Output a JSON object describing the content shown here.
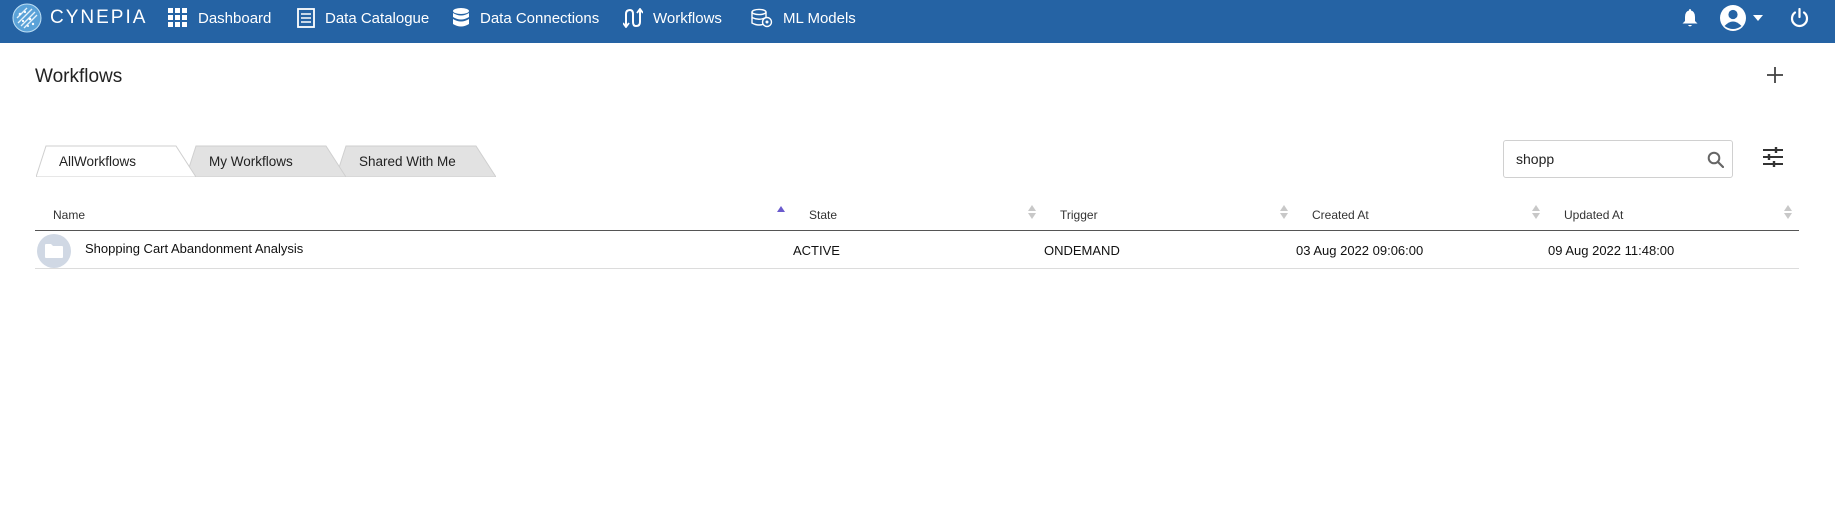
{
  "nav": {
    "brand": "CYNEPIA",
    "items": [
      {
        "label": "Dashboard",
        "icon": "grid-icon"
      },
      {
        "label": "Data Catalogue",
        "icon": "catalogue-icon"
      },
      {
        "label": "Data Connections",
        "icon": "database-icon"
      },
      {
        "label": "Workflows",
        "icon": "workflow-icon"
      },
      {
        "label": "ML Models",
        "icon": "ml-model-icon"
      }
    ],
    "right_icons": [
      "bell-icon",
      "account-icon",
      "power-icon"
    ],
    "bg_color": "#2563a4"
  },
  "page": {
    "title": "Workflows",
    "add_icon": "plus-icon"
  },
  "tabs": [
    {
      "label": "AllWorkflows",
      "active": true
    },
    {
      "label": "My Workflows",
      "active": false
    },
    {
      "label": "Shared With Me",
      "active": false
    }
  ],
  "search": {
    "value": "shopp",
    "placeholder": "Search"
  },
  "table": {
    "columns": [
      "Name",
      "State",
      "Trigger",
      "Created At",
      "Updated At"
    ],
    "sort": {
      "column": "Name",
      "direction": "ascending"
    },
    "rows": [
      {
        "name": "Shopping Cart Abandonment Analysis",
        "state": "ACTIVE",
        "trigger": "ONDEMAND",
        "created_at": "03 Aug 2022 09:06:00",
        "updated_at": "09 Aug 2022 11:48:00",
        "icon": "folder-icon"
      }
    ]
  }
}
